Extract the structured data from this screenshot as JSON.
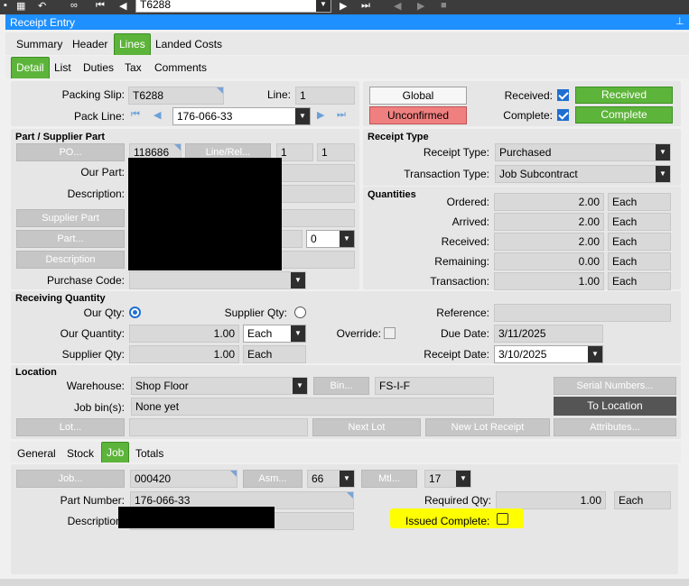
{
  "toolbar": {
    "search_value": "T6288"
  },
  "window": {
    "title": "Receipt Entry",
    "pin_icon": "pin-icon"
  },
  "main_tabs": [
    "Summary",
    "Header",
    "Lines",
    "Landed Costs"
  ],
  "sub_tabs": [
    "Detail",
    "List",
    "Duties",
    "Tax",
    "Comments"
  ],
  "header": {
    "packing_slip_label": "Packing Slip:",
    "packing_slip_value": "T6288",
    "line_label": "Line:",
    "line_value": "1",
    "pack_line_label": "Pack Line:",
    "pack_line_value": "176-066-33",
    "global_button": "Global",
    "unconfirmed_button": "Unconfirmed",
    "received_label": "Received:",
    "received_button": "Received",
    "complete_label": "Complete:",
    "complete_button": "Complete"
  },
  "part": {
    "section_title": "Part / Supplier Part",
    "po_button": "PO...",
    "po_value": "118686",
    "line_rel_button": "Line/Rel...",
    "line_value": "1",
    "rel_value": "1",
    "our_part_label": "Our Part:",
    "description_label": "Description:",
    "supplier_part_button": "Supplier Part",
    "part_button": "Part...",
    "rev_value": "0",
    "description_button": "Description",
    "purchase_code_label": "Purchase Code:"
  },
  "receipt_type": {
    "section_title": "Receipt Type",
    "receipt_type_label": "Receipt Type:",
    "receipt_type_value": "Purchased",
    "transaction_type_label": "Transaction Type:",
    "transaction_type_value": "Job Subcontract"
  },
  "quantities": {
    "section_title": "Quantities",
    "rows": [
      {
        "label": "Ordered:",
        "value": "2.00",
        "uom": "Each"
      },
      {
        "label": "Arrived:",
        "value": "2.00",
        "uom": "Each"
      },
      {
        "label": "Received:",
        "value": "2.00",
        "uom": "Each"
      },
      {
        "label": "Remaining:",
        "value": "0.00",
        "uom": "Each"
      },
      {
        "label": "Transaction:",
        "value": "1.00",
        "uom": "Each"
      }
    ]
  },
  "receiving": {
    "section_title": "Receiving Quantity",
    "our_qty_label": "Our Qty:",
    "supplier_qty_radio_label": "Supplier Qty:",
    "our_quantity_label": "Our Quantity:",
    "our_quantity_value": "1.00",
    "our_uom": "Each",
    "supplier_qty_label": "Supplier Qty:",
    "supplier_qty_value": "1.00",
    "supplier_uom": "Each",
    "override_label": "Override:",
    "reference_label": "Reference:",
    "reference_value": "",
    "due_date_label": "Due Date:",
    "due_date_value": "3/11/2025",
    "receipt_date_label": "Receipt Date:",
    "receipt_date_value": "3/10/2025"
  },
  "location": {
    "section_title": "Location",
    "warehouse_label": "Warehouse:",
    "warehouse_value": "Shop Floor",
    "bin_button": "Bin...",
    "bin_value": "FS-I-F",
    "serial_button": "Serial Numbers...",
    "job_bins_label": "Job bin(s):",
    "job_bins_value": "None yet",
    "to_location_button": "To Location",
    "lot_button": "Lot...",
    "next_lot_button": "Next Lot",
    "new_lot_receipt_button": "New Lot Receipt",
    "attributes_button": "Attributes..."
  },
  "lower_tabs": [
    "General",
    "Stock",
    "Job",
    "Totals"
  ],
  "job": {
    "job_button": "Job...",
    "job_value": "000420",
    "asm_button": "Asm...",
    "asm_value": "66",
    "mtl_button": "Mtl...",
    "mtl_value": "17",
    "part_number_label": "Part Number:",
    "part_number_value": "176-066-33",
    "description_label": "Description:",
    "required_qty_label": "Required Qty:",
    "required_qty_value": "1.00",
    "required_uom": "Each",
    "issued_complete_label": "Issued Complete:"
  },
  "colors": {
    "green": "#5db43a",
    "red": "#f08080",
    "highlight": "#ffff00",
    "titlebar": "#1e90ff"
  }
}
